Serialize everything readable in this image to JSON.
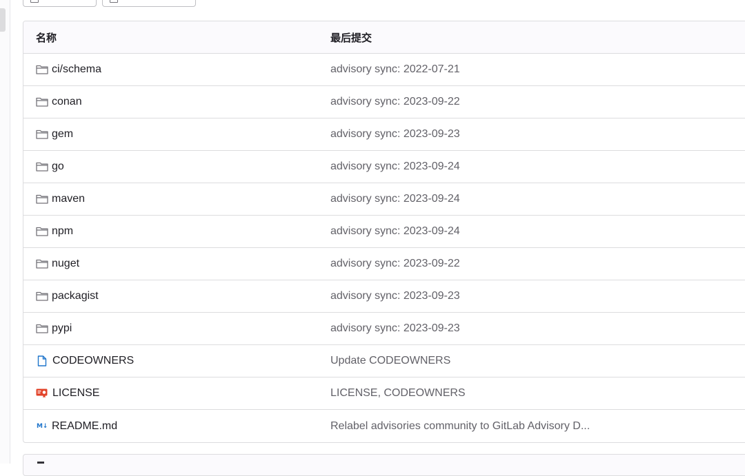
{
  "table": {
    "headers": {
      "name": "名称",
      "last_commit": "最后提交"
    },
    "rows": [
      {
        "type": "folder",
        "name": "ci/schema",
        "commit": "advisory sync: 2022-07-21"
      },
      {
        "type": "folder",
        "name": "conan",
        "commit": "advisory sync: 2023-09-22"
      },
      {
        "type": "folder",
        "name": "gem",
        "commit": "advisory sync: 2023-09-23"
      },
      {
        "type": "folder",
        "name": "go",
        "commit": "advisory sync: 2023-09-24"
      },
      {
        "type": "folder",
        "name": "maven",
        "commit": "advisory sync: 2023-09-24"
      },
      {
        "type": "folder",
        "name": "npm",
        "commit": "advisory sync: 2023-09-24"
      },
      {
        "type": "folder",
        "name": "nuget",
        "commit": "advisory sync: 2023-09-22"
      },
      {
        "type": "folder",
        "name": "packagist",
        "commit": "advisory sync: 2023-09-23"
      },
      {
        "type": "folder",
        "name": "pypi",
        "commit": "advisory sync: 2023-09-23"
      },
      {
        "type": "file",
        "name": "CODEOWNERS",
        "commit": "Update CODEOWNERS"
      },
      {
        "type": "license",
        "name": "LICENSE",
        "commit": "LICENSE, CODEOWNERS"
      },
      {
        "type": "markdown",
        "name": "README.md",
        "commit": "Relabel advisories community to GitLab Advisory D..."
      }
    ]
  },
  "icons": {
    "folder": "folder-icon",
    "file": "file-icon",
    "license": "license-icon",
    "markdown": "markdown-icon",
    "markdown_glyph": "M↓"
  },
  "colors": {
    "folder_icon": "#737278",
    "file_icon": "#1f75cb",
    "license_icon": "#e24329",
    "markdown_icon": "#1f75cb",
    "commit_text": "#626168",
    "border": "#dcdcde"
  }
}
